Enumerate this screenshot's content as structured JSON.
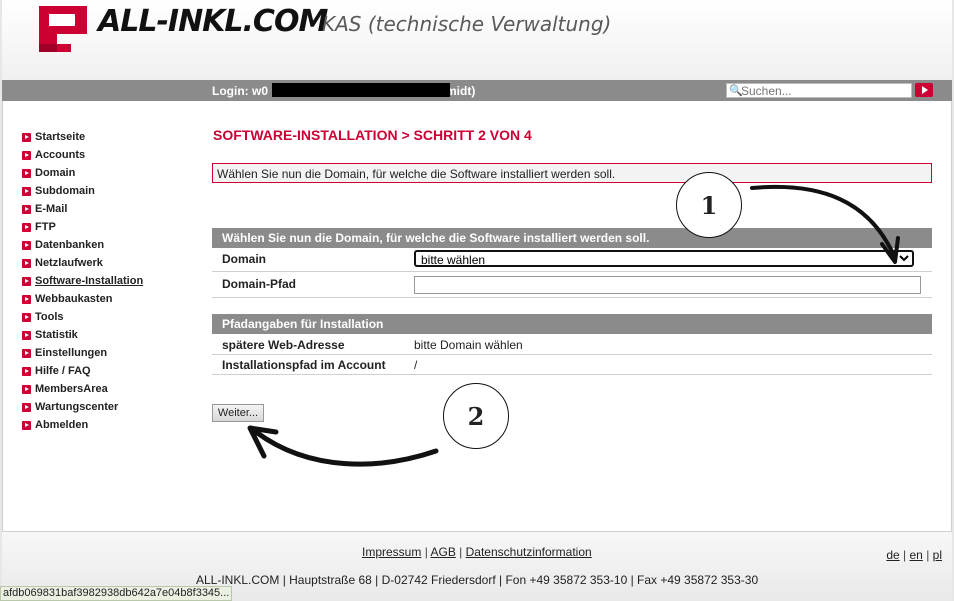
{
  "header": {
    "logo_text": "ALL-INKL.COM",
    "app_title": "KAS (technische Verwaltung)"
  },
  "topbar": {
    "login_label": "Login: w0",
    "login_suffix": "midt)",
    "search_placeholder": "Suchen..."
  },
  "sidebar": {
    "items": [
      {
        "label": "Startseite"
      },
      {
        "label": "Accounts"
      },
      {
        "label": "Domain"
      },
      {
        "label": "Subdomain"
      },
      {
        "label": "E-Mail"
      },
      {
        "label": "FTP"
      },
      {
        "label": "Datenbanken"
      },
      {
        "label": "Netzlaufwerk"
      },
      {
        "label": "Software-Installation",
        "active": true
      },
      {
        "label": "Webbaukasten"
      },
      {
        "label": "Tools"
      },
      {
        "label": "Statistik"
      },
      {
        "label": "Einstellungen"
      },
      {
        "label": "Hilfe / FAQ"
      },
      {
        "label": "MembersArea"
      },
      {
        "label": "Wartungscenter"
      },
      {
        "label": "Abmelden"
      }
    ]
  },
  "main": {
    "page_title": "SOFTWARE-INSTALLATION > SCHRITT 2 VON 4",
    "hint": "Wählen Sie nun die Domain, für welche die Software installiert werden soll.",
    "section1": {
      "heading": "Wählen Sie nun die Domain, für welche die Software installiert werden soll.",
      "domain_label": "Domain",
      "domain_selected": "bitte wählen",
      "pfad_label": "Domain-Pfad",
      "pfad_value": ""
    },
    "section2": {
      "heading": "Pfadangaben für Installation",
      "web_label": "spätere Web-Adresse",
      "web_value": "bitte Domain wählen",
      "path_label": "Installationspfad im Account",
      "path_value": "/"
    },
    "next_button": "Weiter..."
  },
  "annotations": {
    "marker1": "1",
    "marker2": "2"
  },
  "footer": {
    "impressum": "Impressum",
    "agb": "AGB",
    "datenschutz": "Datenschutzinformation",
    "lang_de": "de",
    "lang_en": "en",
    "lang_pl": "pl",
    "address": "ALL-INKL.COM | Hauptstraße 68 | D-02742 Friedersdorf | Fon +49 35872 353-10 | Fax +49 35872 353-30",
    "status_url": "afdb069831baf3982938db642a7e04b8f3345..."
  },
  "colors": {
    "brand": "#cc0033",
    "bar": "#8b8b8b"
  }
}
